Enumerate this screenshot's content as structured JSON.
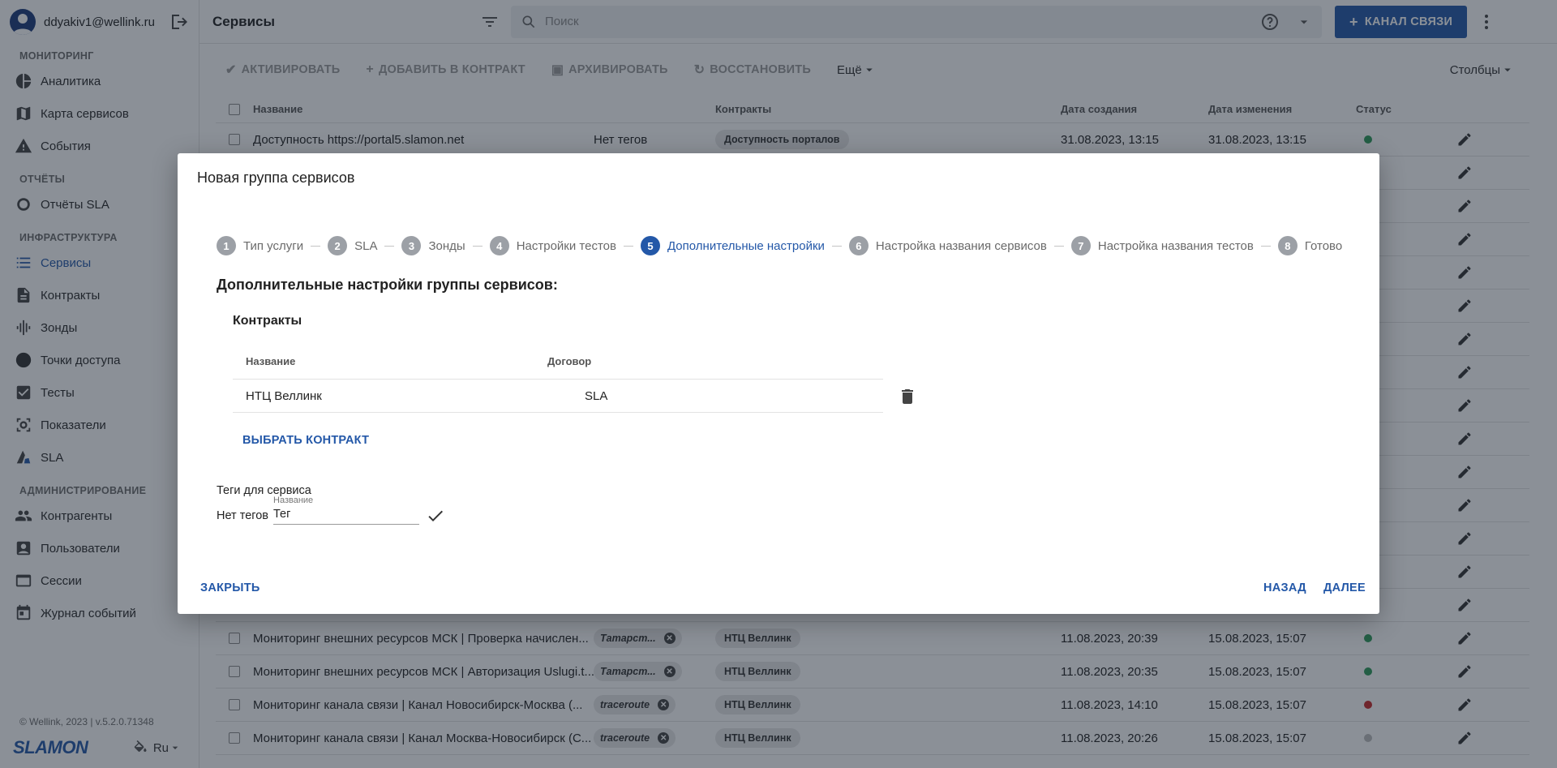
{
  "user": {
    "email": "ddyakiv1@wellink.ru"
  },
  "sidebar": {
    "sections": [
      {
        "title": "МОНИТОРИНГ",
        "items": [
          {
            "label": "Аналитика",
            "icon": "pie-chart-icon"
          },
          {
            "label": "Карта сервисов",
            "icon": "map-icon"
          },
          {
            "label": "События",
            "icon": "warning-icon"
          }
        ]
      },
      {
        "title": "ОТЧЁТЫ",
        "items": [
          {
            "label": "Отчёты SLA",
            "icon": "donut-icon"
          }
        ]
      },
      {
        "title": "ИНФРАСТРУКТУРА",
        "items": [
          {
            "label": "Сервисы",
            "icon": "list-icon",
            "active": true
          },
          {
            "label": "Контракты",
            "icon": "document-icon"
          },
          {
            "label": "Зонды",
            "icon": "waveform-icon"
          },
          {
            "label": "Точки доступа",
            "icon": "circle-icon"
          },
          {
            "label": "Тесты",
            "icon": "checkbox-icon"
          },
          {
            "label": "Показатели",
            "icon": "metrics-icon"
          },
          {
            "label": "SLA",
            "icon": "sla-icon"
          }
        ]
      },
      {
        "title": "АДМИНИСТРИРОВАНИЕ",
        "items": [
          {
            "label": "Контрагенты",
            "icon": "people-icon"
          },
          {
            "label": "Пользователи",
            "icon": "user-card-icon"
          },
          {
            "label": "Сессии",
            "icon": "window-icon"
          },
          {
            "label": "Журнал событий",
            "icon": "calendar-icon"
          }
        ]
      }
    ],
    "copyright": "© Wellink, 2023 | v.5.2.0.71348",
    "logo": "SLAMON",
    "lang": "Ru"
  },
  "topbar": {
    "title": "Сервисы",
    "search_placeholder": "Поиск",
    "primary_button": "КАНАЛ СВЯЗИ"
  },
  "toolbar": {
    "activate": "АКТИВИРОВАТЬ",
    "add_to_contract": "ДОБАВИТЬ В КОНТРАКТ",
    "archive": "АРХИВИРОВАТЬ",
    "restore": "ВОССТАНОВИТЬ",
    "more": "Ещё",
    "columns": "Столбцы"
  },
  "table": {
    "headers": {
      "name": "Название",
      "contracts": "Контракты",
      "created": "Дата создания",
      "modified": "Дата изменения",
      "status": "Статус"
    },
    "rows": [
      {
        "name": "Доступность https://portal5.slamon.net",
        "tags": "Нет тегов",
        "tag_type": "text",
        "contract": "Доступность порталов",
        "created": "31.08.2023, 13:15",
        "modified": "31.08.2023, 13:15",
        "status_color": "#2e9a5a"
      },
      {
        "name": "",
        "tags": "",
        "tag_type": "none",
        "contract": "",
        "created": "",
        "modified": "",
        "status_color": ""
      },
      {
        "name": "",
        "tags": "",
        "tag_type": "none",
        "contract": "",
        "created": "",
        "modified": "",
        "status_color": ""
      },
      {
        "name": "",
        "tags": "",
        "tag_type": "none",
        "contract": "",
        "created": "",
        "modified": "",
        "status_color": ""
      },
      {
        "name": "",
        "tags": "",
        "tag_type": "none",
        "contract": "",
        "created": "",
        "modified": "",
        "status_color": ""
      },
      {
        "name": "",
        "tags": "",
        "tag_type": "none",
        "contract": "",
        "created": "",
        "modified": "",
        "status_color": ""
      },
      {
        "name": "",
        "tags": "",
        "tag_type": "none",
        "contract": "",
        "created": "",
        "modified": "",
        "status_color": ""
      },
      {
        "name": "",
        "tags": "",
        "tag_type": "none",
        "contract": "",
        "created": "",
        "modified": "",
        "status_color": ""
      },
      {
        "name": "",
        "tags": "",
        "tag_type": "none",
        "contract": "",
        "created": "",
        "modified": "",
        "status_color": ""
      },
      {
        "name": "",
        "tags": "",
        "tag_type": "none",
        "contract": "",
        "created": "",
        "modified": "",
        "status_color": ""
      },
      {
        "name": "",
        "tags": "",
        "tag_type": "none",
        "contract": "",
        "created": "",
        "modified": "",
        "status_color": ""
      },
      {
        "name": "",
        "tags": "",
        "tag_type": "none",
        "contract": "",
        "created": "",
        "modified": "",
        "status_color": ""
      },
      {
        "name": "",
        "tags": "",
        "tag_type": "none",
        "contract": "",
        "created": "",
        "modified": "",
        "status_color": ""
      },
      {
        "name": "",
        "tags": "",
        "tag_type": "none",
        "contract": "",
        "created": "",
        "modified": "",
        "status_color": ""
      },
      {
        "name": "",
        "tags": "",
        "tag_type": "none",
        "contract": "",
        "created": "",
        "modified": "",
        "status_color": ""
      },
      {
        "name": "Мониторинг внешних ресурсов МСК | Проверка начислен...",
        "tags": "Татарст...",
        "tag_type": "chip",
        "contract": "НТЦ Веллинк",
        "created": "11.08.2023, 20:39",
        "modified": "15.08.2023, 15:07",
        "status_color": "#2e9a5a"
      },
      {
        "name": "Мониторинг внешних ресурсов МСК | Авторизация Uslugi.t...",
        "tags": "Татарст...",
        "tag_type": "chip",
        "contract": "НТЦ Веллинк",
        "created": "11.08.2023, 20:35",
        "modified": "15.08.2023, 15:07",
        "status_color": "#2e9a5a"
      },
      {
        "name": "Мониторинг канала связи | Канал Новосибирск-Москва (...",
        "tags": "traceroute",
        "tag_type": "chip",
        "contract": "НТЦ Веллинк",
        "created": "11.08.2023, 14:10",
        "modified": "15.08.2023, 15:07",
        "status_color": "#c62828"
      },
      {
        "name": "Мониторинг канала связи | Канал Москва-Новосибирск (С...",
        "tags": "traceroute",
        "tag_type": "chip",
        "contract": "НТЦ Веллинк",
        "created": "11.08.2023, 20:26",
        "modified": "15.08.2023, 15:07",
        "status_color": "#bdbdbd"
      }
    ]
  },
  "modal": {
    "title": "Новая группа сервисов",
    "steps": [
      {
        "num": "1",
        "label": "Тип услуги"
      },
      {
        "num": "2",
        "label": "SLA"
      },
      {
        "num": "3",
        "label": "Зонды"
      },
      {
        "num": "4",
        "label": "Настройки тестов"
      },
      {
        "num": "5",
        "label": "Дополнительные настройки",
        "active": true
      },
      {
        "num": "6",
        "label": "Настройка названия сервисов"
      },
      {
        "num": "7",
        "label": "Настройка названия тестов"
      },
      {
        "num": "8",
        "label": "Готово"
      }
    ],
    "section_heading": "Дополнительные настройки группы сервисов:",
    "contracts_title": "Контракты",
    "contracts_table": {
      "headers": {
        "name": "Название",
        "agreement": "Договор"
      },
      "rows": [
        {
          "name": "НТЦ Веллинк",
          "agreement": "SLA"
        }
      ]
    },
    "choose_contract": "ВЫБРАТЬ КОНТРАКТ",
    "tags_label": "Теги для сервиса",
    "no_tags": "Нет тегов",
    "tag_field": {
      "label": "Название",
      "value": "Тег"
    },
    "close": "ЗАКРЫТЬ",
    "back": "НАЗАД",
    "next": "ДАЛЕЕ"
  },
  "colors": {
    "accent": "#2458a8",
    "overlay": "rgba(24,34,48,0.5)"
  }
}
